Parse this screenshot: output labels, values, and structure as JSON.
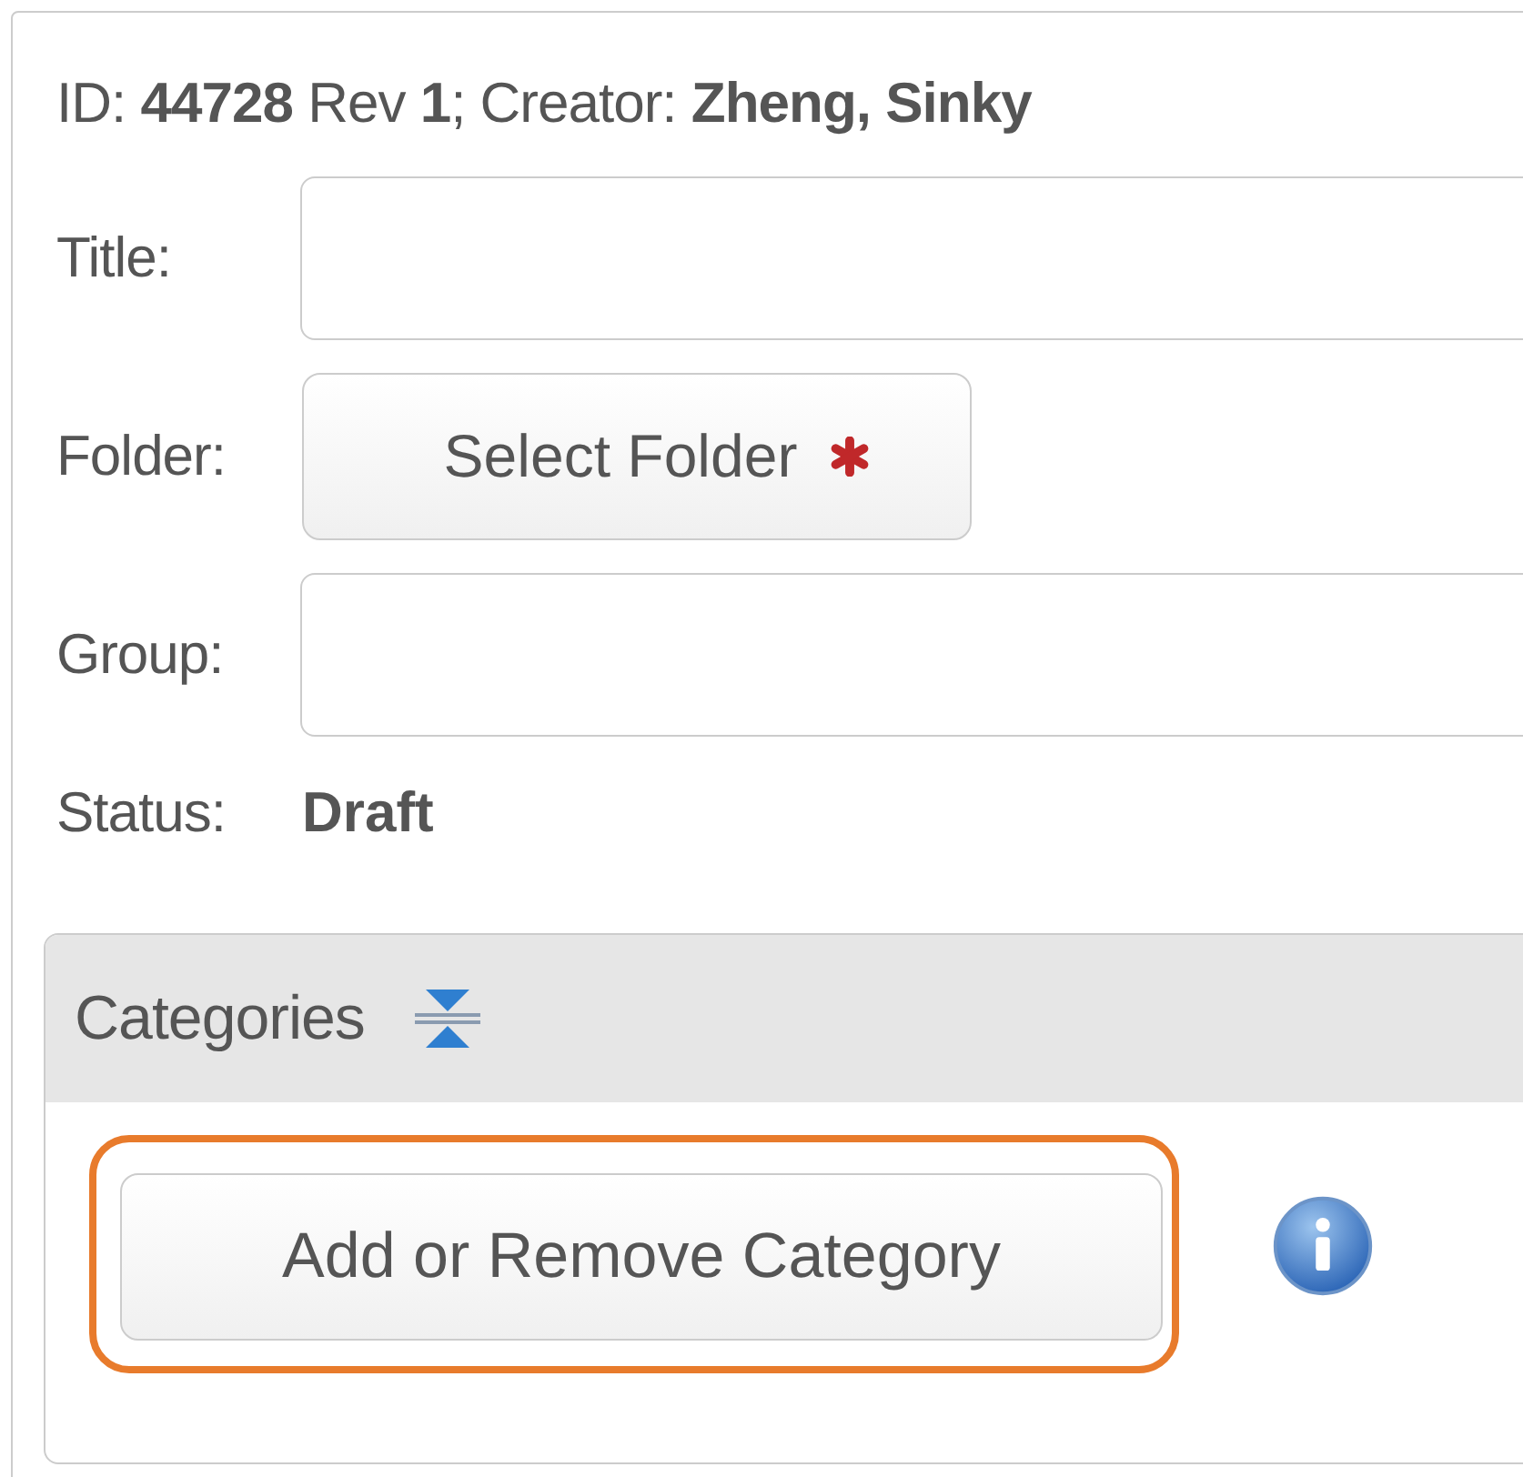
{
  "header": {
    "text": "ID: **44728** Rev **1**; Creator: **Zheng, Sinky**"
  },
  "fields": [
    {
      "kind": "input",
      "label": "Title:"
    },
    {
      "kind": "button",
      "label": "Folder:",
      "button": "Select Folder",
      "required": true
    },
    {
      "kind": "input",
      "label": "Group:"
    },
    {
      "kind": "text",
      "label": "Status:",
      "value": "Draft"
    }
  ],
  "categories": {
    "title": "Categories",
    "button": "Add or Remove Category",
    "highlighted": true
  }
}
